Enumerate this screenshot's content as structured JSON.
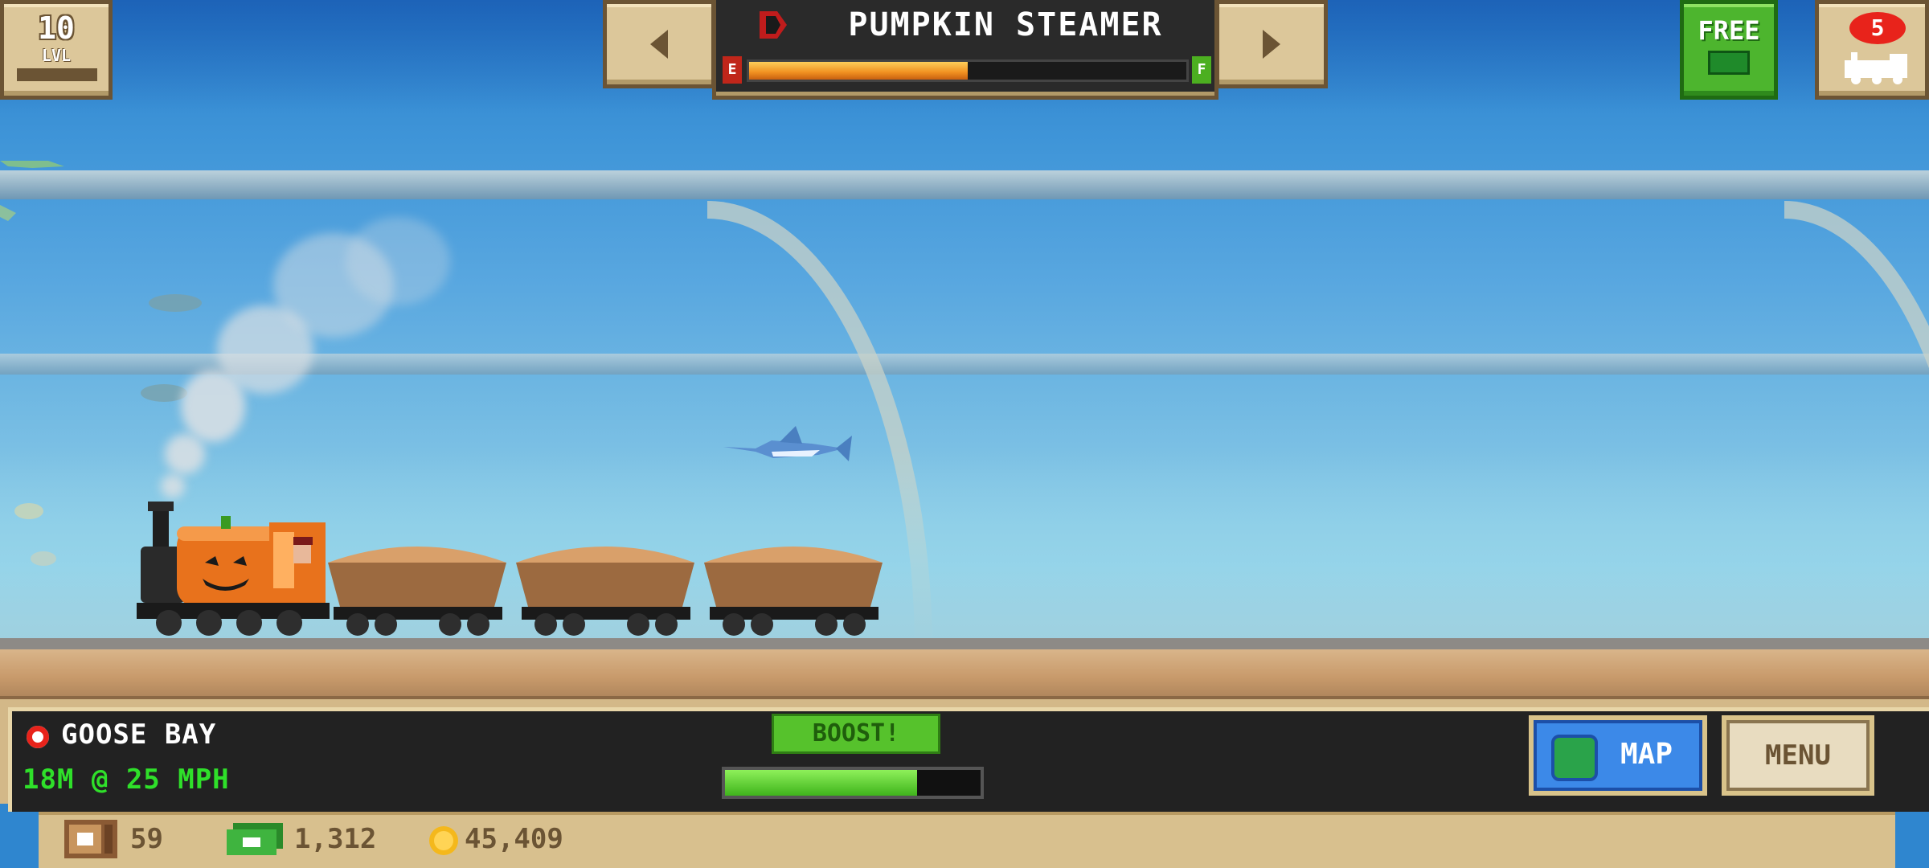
{
  "player": {
    "level": "10",
    "level_label": "LVL"
  },
  "train_selector": {
    "name": "PUMPKIN STEAMER",
    "fuel_fraction": 0.5,
    "fuel_empty_label": "E",
    "fuel_full_label": "F"
  },
  "top_right": {
    "free_label": "FREE",
    "trains_count": "5"
  },
  "route": {
    "station": "GOOSE BAY",
    "speed": "18M @ 25 MPH"
  },
  "boost": {
    "label": "BOOST!",
    "fraction": 0.75
  },
  "buttons": {
    "map_label": "MAP",
    "menu_label": "MENU"
  },
  "resources": {
    "crates": "59",
    "cash": "1,312",
    "coins": "45,409"
  },
  "colors": {
    "fuel": "#f09020",
    "boost": "#3fb41c",
    "station_marker": "#e8231b",
    "speed_text": "#2fe02a"
  },
  "icons": [
    "arrow-left-icon",
    "arrow-right-icon",
    "steam-icon",
    "cash-icon",
    "train-icon",
    "globe-icon",
    "crate-icon",
    "coin-icon"
  ]
}
